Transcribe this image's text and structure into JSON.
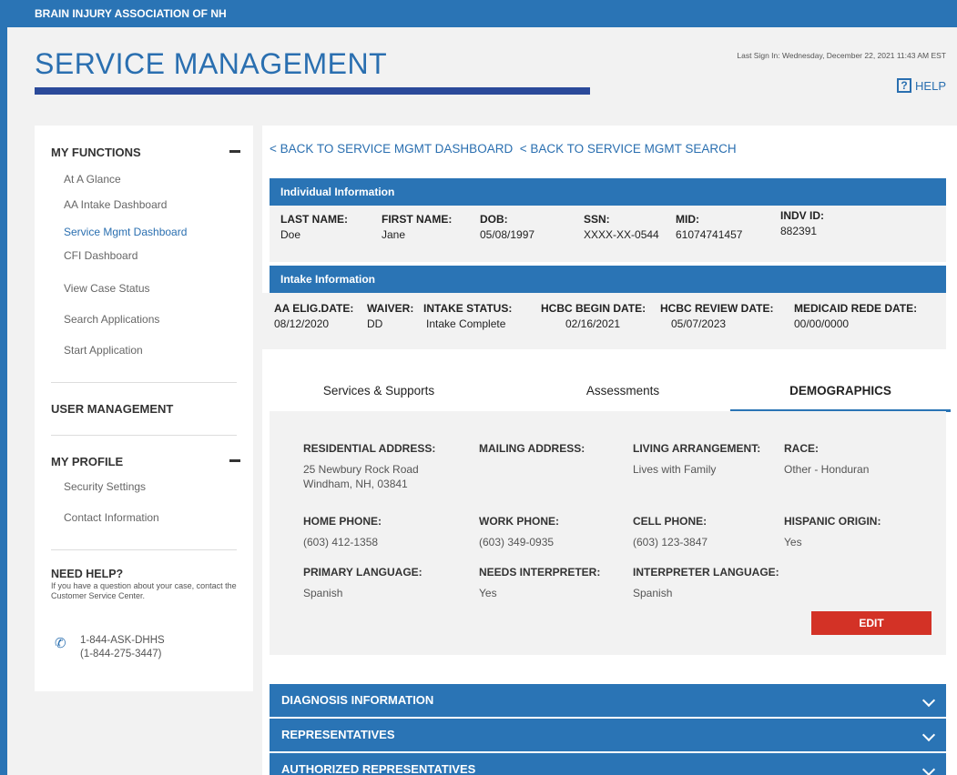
{
  "header": {
    "org": "BRAIN INJURY ASSOCIATION OF NH",
    "title": "SERVICE MANAGEMENT",
    "last_sign_in": "Last Sign In: Wednesday, December 22, 2021 11:43 AM EST",
    "help_label": "HELP",
    "help_icon": "?"
  },
  "sidebar": {
    "my_functions": {
      "title": "MY FUNCTIONS",
      "items": [
        "At A Glance",
        "AA Intake Dashboard",
        "Service Mgmt Dashboard",
        "CFI Dashboard",
        "View Case Status",
        "Search Applications",
        "Start Application"
      ],
      "active_index": 2
    },
    "user_management": {
      "title": "USER MANAGEMENT"
    },
    "my_profile": {
      "title": "MY PROFILE",
      "items": [
        "Security Settings",
        "Contact Information"
      ]
    },
    "need_help": {
      "title": "NEED HELP?",
      "text": "If you have a question about your case, contact the Customer Service Center.",
      "phone_1": "1-844-ASK-DHHS",
      "phone_2": "(1-844-275-3447)"
    }
  },
  "main": {
    "back_links": [
      "< BACK TO SERVICE MGMT DASHBOARD",
      "< BACK TO SERVICE MGMT SEARCH"
    ],
    "individual": {
      "title": "Individual Information",
      "fields": [
        {
          "label": "LAST NAME:",
          "value": "Doe"
        },
        {
          "label": "FIRST NAME:",
          "value": "Jane"
        },
        {
          "label": "DOB:",
          "value": "05/08/1997"
        },
        {
          "label": "SSN:",
          "value": "XXXX-XX-0544"
        },
        {
          "label": "MID:",
          "value": "61074741457"
        },
        {
          "label": "INDV ID:",
          "value": "882391"
        }
      ]
    },
    "intake": {
      "title": "Intake Information",
      "fields": [
        {
          "label": "AA ELIG.DATE:",
          "value": "08/12/2020"
        },
        {
          "label": "WAIVER:",
          "value": "DD"
        },
        {
          "label": "INTAKE STATUS:",
          "value": "Intake Complete"
        },
        {
          "label": "HCBC BEGIN DATE:",
          "value": "02/16/2021"
        },
        {
          "label": "HCBC REVIEW DATE:",
          "value": "05/07/2023"
        },
        {
          "label": "MEDICAID REDE DATE:",
          "value": "00/00/0000"
        }
      ]
    },
    "tabs": [
      "Services & Supports",
      "Assessments",
      "DEMOGRAPHICS"
    ],
    "active_tab": 2,
    "demographics": {
      "residential_address": {
        "label": "RESIDENTIAL ADDRESS:",
        "line1": "25 Newbury Rock Road",
        "line2": "Windham, NH, 03841"
      },
      "mailing_address": {
        "label": "MAILING ADDRESS:",
        "value": ""
      },
      "living_arrangement": {
        "label": "LIVING ARRANGEMENT:",
        "value": "Lives with Family"
      },
      "race": {
        "label": "RACE:",
        "value": "Other - Honduran"
      },
      "home_phone": {
        "label": "HOME PHONE:",
        "value": "(603) 412-1358"
      },
      "work_phone": {
        "label": "WORK PHONE:",
        "value": "(603) 349-0935"
      },
      "cell_phone": {
        "label": "CELL PHONE:",
        "value": "(603) 123-3847"
      },
      "hispanic_origin": {
        "label": "HISPANIC ORIGIN:",
        "value": "Yes"
      },
      "primary_language": {
        "label": "PRIMARY LANGUAGE:",
        "value": "Spanish"
      },
      "needs_interpreter": {
        "label": "NEEDS INTERPRETER:",
        "value": "Yes"
      },
      "interpreter_language": {
        "label": "INTERPRETER LANGUAGE:",
        "value": "Spanish"
      },
      "edit_label": "EDIT"
    },
    "accordions": [
      "DIAGNOSIS INFORMATION",
      "REPRESENTATIVES",
      "AUTHORIZED REPRESENTATIVES"
    ]
  },
  "colors": {
    "brand_blue": "#2a74b5",
    "edit_red": "#d33226",
    "link_blue": "#2a6fb0"
  },
  "icons": {
    "phone": "phone-icon",
    "help": "help-icon",
    "collapse": "minus-icon",
    "expand": "chevron-down-icon"
  }
}
